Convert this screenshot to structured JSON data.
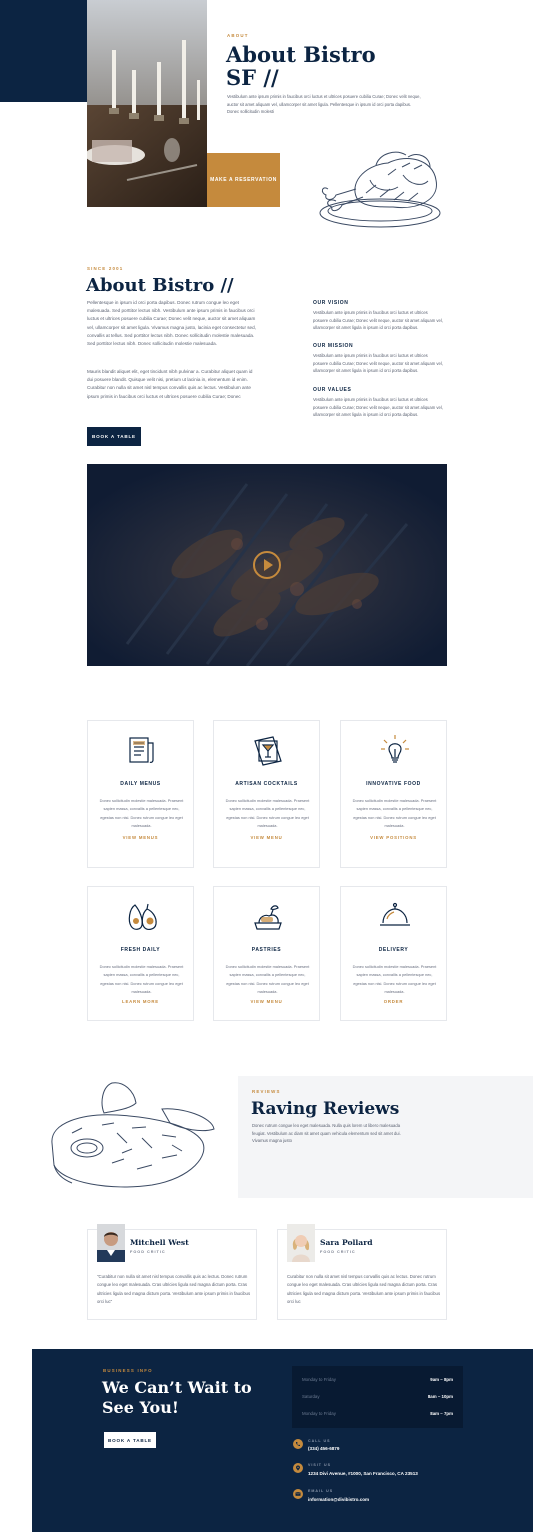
{
  "hero": {
    "eyebrow": "ABOUT",
    "title_line1": "About Bistro",
    "title_line2": "SF //",
    "text": "Vestibulum ante ipsum primis in faucibus orci luctus et ultrices posuere cubilia Curae; Donec velit neque, auctor sit amet aliquam vel, ullamcorper sit amet ligula. Pellentesque in ipsum id orci porta dapibus. Donec sollicitudin molesti",
    "reserve_label": "MAKE A RESERVATION"
  },
  "about": {
    "eyebrow": "SINCE 2001",
    "title": "About Bistro //",
    "para1": "Pellentesque in ipsum id orci porta dapibus. Donec rutrum congue leo eget malesuada. Sed porttitor lectus nibh. Vestibulum ante ipsum primis in faucibus orci luctus et ultrices posuere cubilia Curae; Donec velit neque, auctor sit amet aliquam vel, ullamcorper sit amet ligula. Vivamus magna justo, lacinia eget consectetur sed, convallis at tellus. Sed porttitor lectus nibh. Donec sollicitudin molestie malesuada. Sed porttitor lectus nibh. Donec sollicitudin molestie malesuada.",
    "para2": "Mauris blandit aliquet elit, eget tincidunt nibh pulvinar a. Curabitur aliquet quam id dui posuere blandit. Quisque velit nisi, pretium ut lacinia in, elementum id enim. Curabitur non nulla sit amet nisl tempus convallis quis ac lectus. Vestibulum ante ipsum primis in faucibus orci luctus et ultrices posuere cubilia Curae; Donec",
    "book_label": "BOOK A TABLE",
    "vision_title": "OUR VISION",
    "vision_text": "Vestibulum ante ipsum primis in faucibus orci luctus et ultrices posuere cubilia Curae; Donec velit neque, auctor sit amet aliquam vel, ullamcorper sit amet ligula in ipsum id orci porta dapibus.",
    "mission_title": "OUR MISSION",
    "mission_text": "Vestibulum ante ipsum primis in faucibus orci luctus et ultrices posuere cubilia Curae; Donec velit neque, auctor sit amet aliquam vel, ullamcorper sit amet ligula in ipsum id orci porta dapibus.",
    "values_title": "OUR VALUES",
    "values_text": "Vestibulum ante ipsum primis in faucibus orci luctus et ultrices posuere cubilia Curae; Donec velit neque, auctor sit amet aliquam vel, ullamcorper sit amet ligula in ipsum id orci porta dapibus."
  },
  "features": [
    {
      "title": "DAILY MENUS",
      "text": "Donec sollicitudin molestie malesuada. Praesent sapien massa, convallis a pellentesque nec, egestas non nisi. Donec rutrum congue leo eget malesuada.",
      "link": "VIEW MENUS",
      "icon": "menu-icon"
    },
    {
      "title": "ARTISAN COCKTAILS",
      "text": "Donec sollicitudin molestie malesuada. Praesent sapien massa, convallis a pellentesque nec, egestas non nisi. Donec rutrum congue leo eget malesuada.",
      "link": "VIEW MENU",
      "icon": "cocktail-icon"
    },
    {
      "title": "INNOVATIVE FOOD",
      "text": "Donec sollicitudin molestie malesuada. Praesent sapien massa, convallis a pellentesque nec, egestas non nisi. Donec rutrum congue leo eget malesuada.",
      "link": "VIEW POSITIONS",
      "icon": "lightbulb-icon"
    },
    {
      "title": "FRESH DAILY",
      "text": "Donec sollicitudin molestie malesuada. Praesent sapien massa, convallis a pellentesque nec, egestas non nisi. Donec rutrum congue leo eget malesuada.",
      "link": "LEARN MORE",
      "icon": "avocado-icon"
    },
    {
      "title": "PASTRIES",
      "text": "Donec sollicitudin molestie malesuada. Praesent sapien massa, convallis a pellentesque nec, egestas non nisi. Donec rutrum congue leo eget malesuada.",
      "link": "VIEW MENU",
      "icon": "pastry-icon"
    },
    {
      "title": "DELIVERY",
      "text": "Donec sollicitudin molestie malesuada. Praesent sapien massa, convallis a pellentesque nec, egestas non nisi. Donec rutrum congue leo eget malesuada.",
      "link": "ORDER",
      "icon": "cloche-icon"
    }
  ],
  "reviews": {
    "eyebrow": "REVIEWS",
    "title": "Raving Reviews",
    "text": "Donec rutrum congue leo eget malesuada. Nulla quis lorem ut libero malesuada feugiat. Vestibulum ac diam sit amet quam vehicula elementum sed sit amet dui. Vivamus magna justo",
    "items": [
      {
        "name": "Mitchell West",
        "role": "FOOD CRITIC",
        "quote": "\"Curabitur non nulla sit amet nisl tempus convallis quis ac lectus. Donec rutrum congue leo eget malesuada. Cras ultricies ligula sed magna dictum porta. Cras ultricies ligula sed magna dictum porta. Vestibulum ante ipsum primis in faucibus orci luc\""
      },
      {
        "name": "Sara Pollard",
        "role": "FOOD CRITIC",
        "quote": "Curabitur non nulla sit amet nisl tempus convallis quis ac lectus. Donec rutrum congue leo eget malesuada. Cras ultricies ligula sed magna dictum porta. Cras ultricies ligula sed magna dictum porta. Vestibulum ante ipsum primis in faucibus orci luc"
      }
    ]
  },
  "footer": {
    "eyebrow": "BUSINESS INFO",
    "title_line1": "We Can’t Wait to",
    "title_line2": "See You!",
    "book_label": "BOOK A TABLE",
    "hours": [
      {
        "day": "Monday to Friday",
        "time": "9am – 8pm"
      },
      {
        "day": "Saturday",
        "time": "8am – 10pm"
      },
      {
        "day": "Monday to Friday",
        "time": "8am – 7pm"
      }
    ],
    "contacts": [
      {
        "label": "CALL US",
        "value": "(334) 456-6879",
        "icon": "phone-icon"
      },
      {
        "label": "VISIT US",
        "value": "1234 Divi Avenue, #1000, San Francisco, CA 23513",
        "icon": "location-icon"
      },
      {
        "label": "EMAIL US",
        "value": "information@divibistro.com",
        "icon": "email-icon"
      }
    ]
  },
  "colors": {
    "navy": "#0c2442",
    "gold": "#c58a3d",
    "panel": "#f4f5f7"
  }
}
